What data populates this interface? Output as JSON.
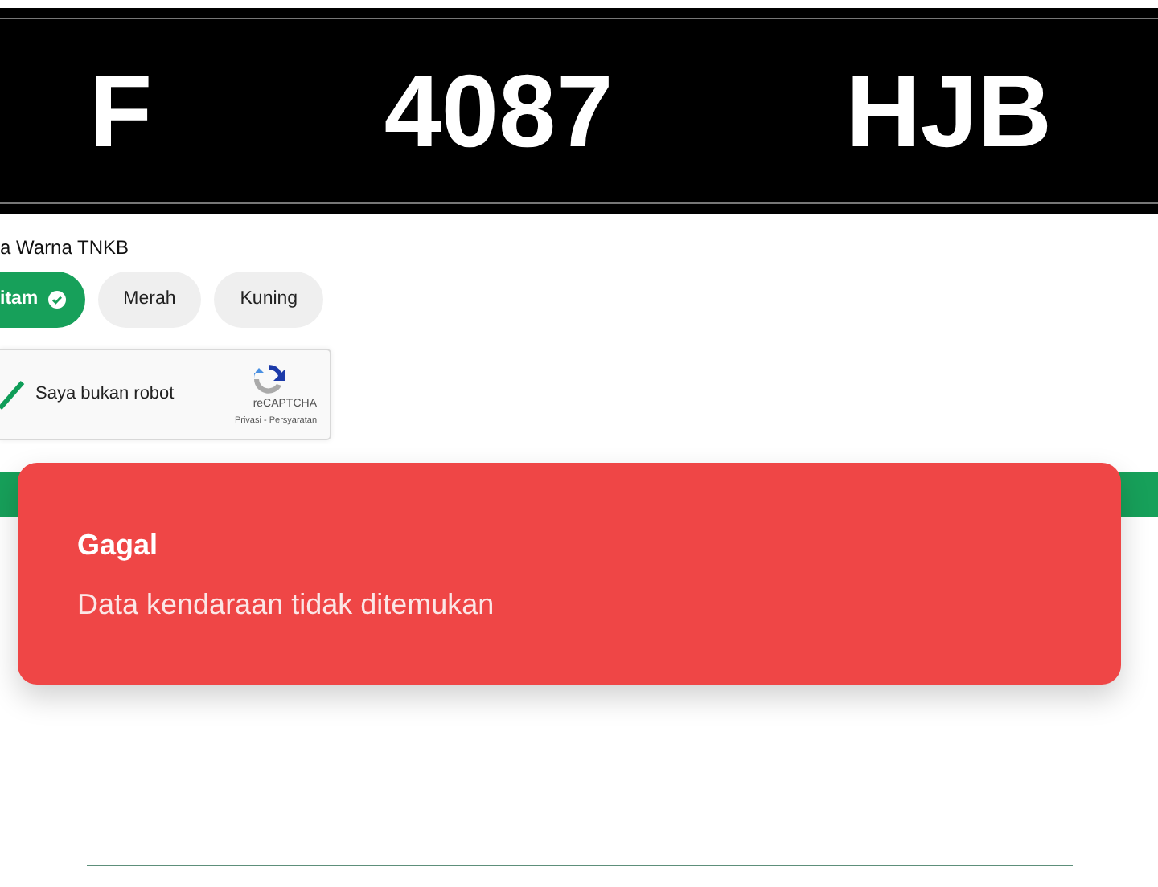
{
  "plate": {
    "region": "F",
    "number": "4087",
    "suffix": "HJB"
  },
  "color_label": "a Warna TNKB",
  "colors": [
    {
      "label": "itam",
      "selected": true
    },
    {
      "label": "Merah",
      "selected": false
    },
    {
      "label": "Kuning",
      "selected": false
    }
  ],
  "captcha": {
    "label": "Saya bukan robot",
    "checked": true,
    "brand": "reCAPTCHA",
    "links": "Privasi - Persyaratan"
  },
  "toast": {
    "title": "Gagal",
    "message": "Data kendaraan tidak ditemukan"
  }
}
